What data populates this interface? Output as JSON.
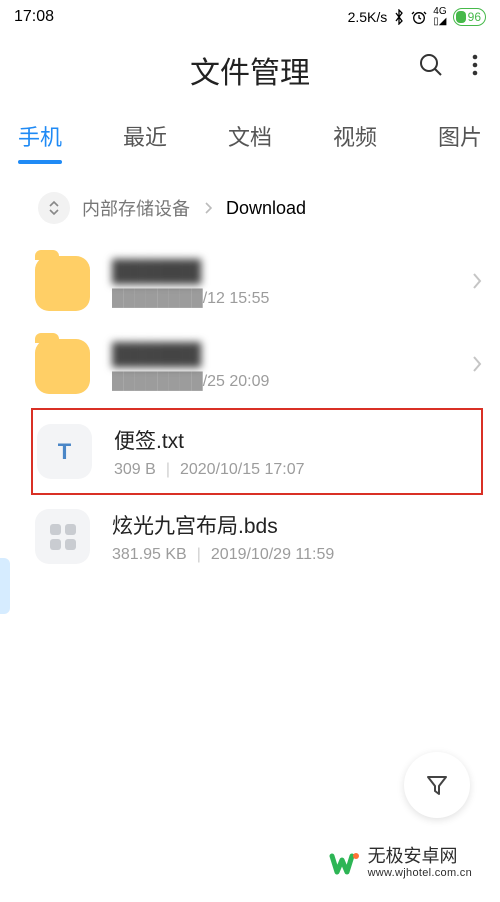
{
  "status": {
    "time": "17:08",
    "net_speed": "2.5K/s",
    "battery_percent": "96"
  },
  "header": {
    "title": "文件管理"
  },
  "tabs": [
    {
      "label": "手机",
      "active": true
    },
    {
      "label": "最近",
      "active": false
    },
    {
      "label": "文档",
      "active": false
    },
    {
      "label": "视频",
      "active": false
    },
    {
      "label": "图片",
      "active": false
    }
  ],
  "breadcrumb": {
    "root": "内部存储设备",
    "current": "Download"
  },
  "files": [
    {
      "icon": "folder-icon",
      "name": "██████",
      "name_blurred": true,
      "detail_prefix": "████████",
      "detail_prefix_blurred": true,
      "detail_suffix": "/12 15:55",
      "chevron": true,
      "highlighted": false
    },
    {
      "icon": "folder-icon",
      "name": "██████",
      "name_blurred": true,
      "detail_prefix": "████████",
      "detail_prefix_blurred": true,
      "detail_suffix": "/25 20:09",
      "chevron": true,
      "highlighted": false
    },
    {
      "icon": "txt-icon",
      "icon_label": "T",
      "name": "便签.txt",
      "name_blurred": false,
      "size": "309 B",
      "date": "2020/10/15 17:07",
      "chevron": false,
      "highlighted": true
    },
    {
      "icon": "bds-icon",
      "name": "炫光九宫布局.bds",
      "name_blurred": false,
      "size": "381.95 KB",
      "date": "2019/10/29 11:59",
      "chevron": false,
      "highlighted": false
    }
  ],
  "watermark": {
    "title": "无极安卓网",
    "url": "www.wjhotel.com.cn"
  }
}
